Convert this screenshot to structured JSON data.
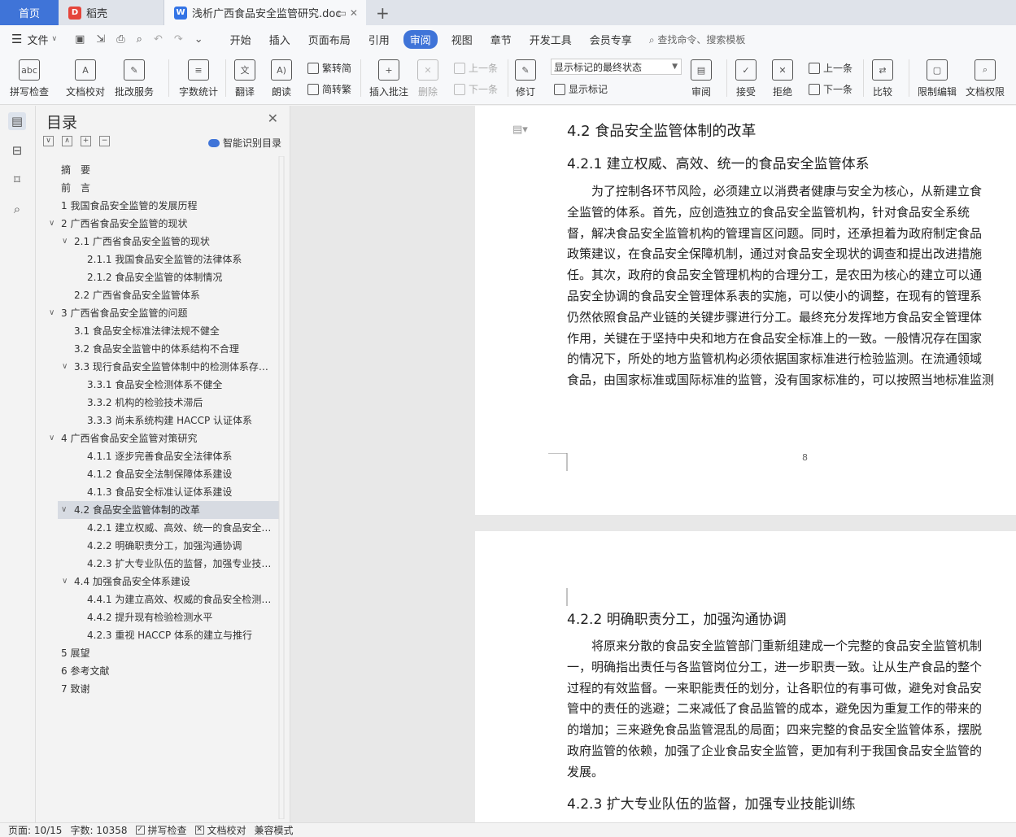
{
  "tabs": {
    "home": "首页",
    "daoke": "稻壳",
    "doc": "浅析广西食品安全监管研究.doc",
    "new_tab": "+"
  },
  "menu": {
    "file": "文件",
    "items": [
      "开始",
      "插入",
      "页面布局",
      "引用",
      "审阅",
      "视图",
      "章节",
      "开发工具",
      "会员专享"
    ],
    "active_index": 4,
    "search": "查找命令、搜索模板"
  },
  "ribbon": {
    "spell_check": "拼写检查",
    "doc_proof": "文档校对",
    "batch_service": "批改服务",
    "word_count": "字数统计",
    "translate": "翻译",
    "read_aloud": "朗读",
    "to_traditional": "繁转简",
    "to_simplified": "简转繁",
    "insert_comment": "插入批注",
    "delete": "删除",
    "prev_comment": "上一条",
    "next_comment": "下一条",
    "track_changes": "修订",
    "markup_state": "显示标记的最终状态",
    "show_markup": "显示标记",
    "review": "审阅",
    "accept": "接受",
    "reject": "拒绝",
    "prev_change": "上一条",
    "next_change": "下一条",
    "compare": "比较",
    "restrict_edit": "限制编辑",
    "doc_permission": "文档权限"
  },
  "toc": {
    "title": "目录",
    "smart_toc": "智能识别目录",
    "items": [
      {
        "text": "摘　要",
        "level": 1,
        "expand": ""
      },
      {
        "text": "前　言",
        "level": 1,
        "expand": ""
      },
      {
        "text": "1 我国食品安全监管的发展历程",
        "level": 1,
        "expand": ""
      },
      {
        "text": "2 广西省食品安全监管的现状",
        "level": 1,
        "expand": "v"
      },
      {
        "text": "2.1 广西省食品安全监管的现状",
        "level": 2,
        "expand": "v"
      },
      {
        "text": "2.1.1 我国食品安全监管的法律体系",
        "level": 3,
        "expand": ""
      },
      {
        "text": "2.1.2 食品安全监管的体制情况",
        "level": 3,
        "expand": ""
      },
      {
        "text": "2.2 广西省食品安全监管体系",
        "level": 2,
        "expand": ""
      },
      {
        "text": "3 广西省食品安全监管的问题",
        "level": 1,
        "expand": "v"
      },
      {
        "text": "3.1 食品安全标准法律法规不健全",
        "level": 2,
        "expand": ""
      },
      {
        "text": "3.2 食品安全监管中的体系结构不合理",
        "level": 2,
        "expand": ""
      },
      {
        "text": "3.3 现行食品安全监管体制中的检测体系存…",
        "level": 2,
        "expand": "v"
      },
      {
        "text": "3.3.1 食品安全检测体系不健全",
        "level": 3,
        "expand": ""
      },
      {
        "text": "3.3.2 机构的检验技术滞后",
        "level": 3,
        "expand": ""
      },
      {
        "text": "3.3.3 尚未系统构建 HACCP 认证体系",
        "level": 3,
        "expand": ""
      },
      {
        "text": "4 广西省食品安全监管对策研究",
        "level": 1,
        "expand": "v"
      },
      {
        "text": "4.1.1 逐步完善食品安全法律体系",
        "level": 3,
        "expand": ""
      },
      {
        "text": "4.1.2 食品安全法制保障体系建设",
        "level": 3,
        "expand": ""
      },
      {
        "text": "4.1.3 食品安全标准认证体系建设",
        "level": 3,
        "expand": ""
      },
      {
        "text": "4.2 食品安全监管体制的改革",
        "level": 2,
        "expand": "v",
        "selected": true
      },
      {
        "text": "4.2.1 建立权威、高效、统一的食品安全…",
        "level": 3,
        "expand": ""
      },
      {
        "text": "4.2.2 明确职责分工，加强沟通协调",
        "level": 3,
        "expand": ""
      },
      {
        "text": "4.2.3 扩大专业队伍的监督，加强专业技…",
        "level": 3,
        "expand": ""
      },
      {
        "text": "4.4 加强食品安全体系建设",
        "level": 2,
        "expand": "v"
      },
      {
        "text": "4.4.1 为建立高效、权威的食品安全检测…",
        "level": 3,
        "expand": ""
      },
      {
        "text": "4.4.2 提升现有检验检测水平",
        "level": 3,
        "expand": ""
      },
      {
        "text": "4.2.3 重视 HACCP 体系的建立与推行",
        "level": 3,
        "expand": ""
      },
      {
        "text": "5 展望",
        "level": 1,
        "expand": ""
      },
      {
        "text": "6 参考文献",
        "level": 1,
        "expand": ""
      },
      {
        "text": "7 致谢",
        "level": 1,
        "expand": ""
      }
    ]
  },
  "document": {
    "page1": {
      "h2": "4.2 食品安全监管体制的改革",
      "h3": "4.2.1 建立权威、高效、统一的食品安全监管体系",
      "lines": [
        "　　为了控制各环节风险，必须建立以消费者健康与安全为核心，从新建立食",
        "全监管的体系。首先，应创造独立的食品安全监管机构，针对食品安全系统",
        "督，解决食品安全监管机构的管理盲区问题。同时，还承担着为政府制定食品",
        "政策建议，在食品安全保障机制，通过对食品安全现状的调查和提出改进措施",
        "任。其次，政府的食品安全管理机构的合理分工，是农田为核心的建立可以通",
        "品安全协调的食品安全管理体系表的实施，可以使小的调整，在现有的管理系",
        "仍然依照食品产业链的关键步骤进行分工。最终充分发挥地方食品安全管理体",
        "作用，关键在于坚持中央和地方在食品安全标准上的一致。一般情况存在国家",
        "的情况下，所处的地方监管机构必须依据国家标准进行检验监测。在流通领域",
        "食品，由国家标准或国际标准的监管，没有国家标准的，可以按照当地标准监测"
      ],
      "page_number": "8"
    },
    "page2": {
      "h3a": "4.2.2 明确职责分工，加强沟通协调",
      "lines": [
        "　　将原来分散的食品安全监管部门重新组建成一个完整的食品安全监管机制",
        "一，明确指出责任与各监管岗位分工，进一步职责一致。让从生产食品的整个",
        "过程的有效监督。一来职能责任的划分，让各职位的有事可做，避免对食品安",
        "管中的责任的逃避；二来减低了食品监管的成本，避免因为重复工作的带来的",
        "的增加；三来避免食品监管混乱的局面；四来完整的食品安全监管体系，摆脱",
        "政府监管的依赖，加强了企业食品安全监管，更加有利于我国食品安全监管的",
        "发展。"
      ],
      "h3b": "4.2.3 扩大专业队伍的监督，加强专业技能训练"
    }
  },
  "status": {
    "page": "页面: 10/15",
    "words": "字数: 10358",
    "spell": "拼写检查",
    "proof": "文档校对",
    "compat": "兼容模式"
  },
  "colors": {
    "accent": "#3f74d8",
    "selected_toc": "#d7dbe2"
  }
}
